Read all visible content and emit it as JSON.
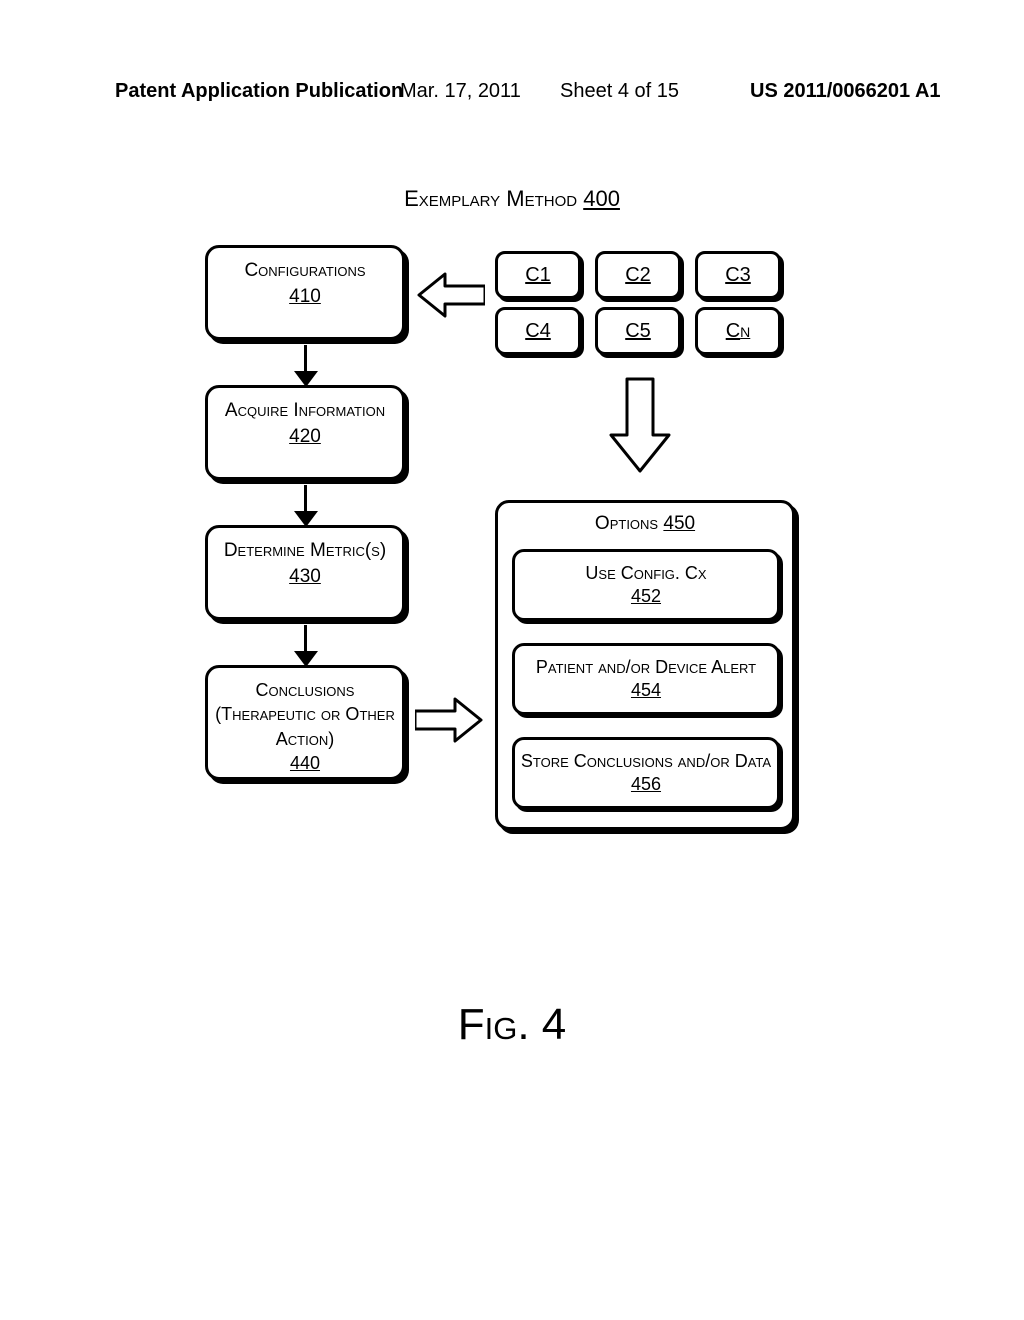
{
  "header": {
    "pub": "Patent Application Publication",
    "date": "Mar. 17, 2011",
    "sheet": "Sheet 4 of 15",
    "docnum": "US 2011/0066201 A1"
  },
  "title": {
    "text": "Exemplary Method ",
    "num": "400"
  },
  "flow": {
    "b410": {
      "label": "Configurations",
      "num": "410"
    },
    "b420": {
      "label": "Acquire Information",
      "num": "420"
    },
    "b430": {
      "label": "Determine Metric(s)",
      "num": "430"
    },
    "b440": {
      "label": "Conclusions (Therapeutic or Other Action)",
      "num": "440"
    }
  },
  "configs": {
    "c1": "C1",
    "c2": "C2",
    "c3": "C3",
    "c4": "C4",
    "c5": "C5",
    "cn_base": "C",
    "cn_sub": "N"
  },
  "options": {
    "head": "Options ",
    "head_num": "450",
    "o452": {
      "label": "Use Config. Cx",
      "num": "452"
    },
    "o454": {
      "label": "Patient and/or Device Alert",
      "num": "454"
    },
    "o456": {
      "label": "Store Conclusions and/or Data ",
      "num": "456"
    }
  },
  "figcap": "Fig. 4"
}
